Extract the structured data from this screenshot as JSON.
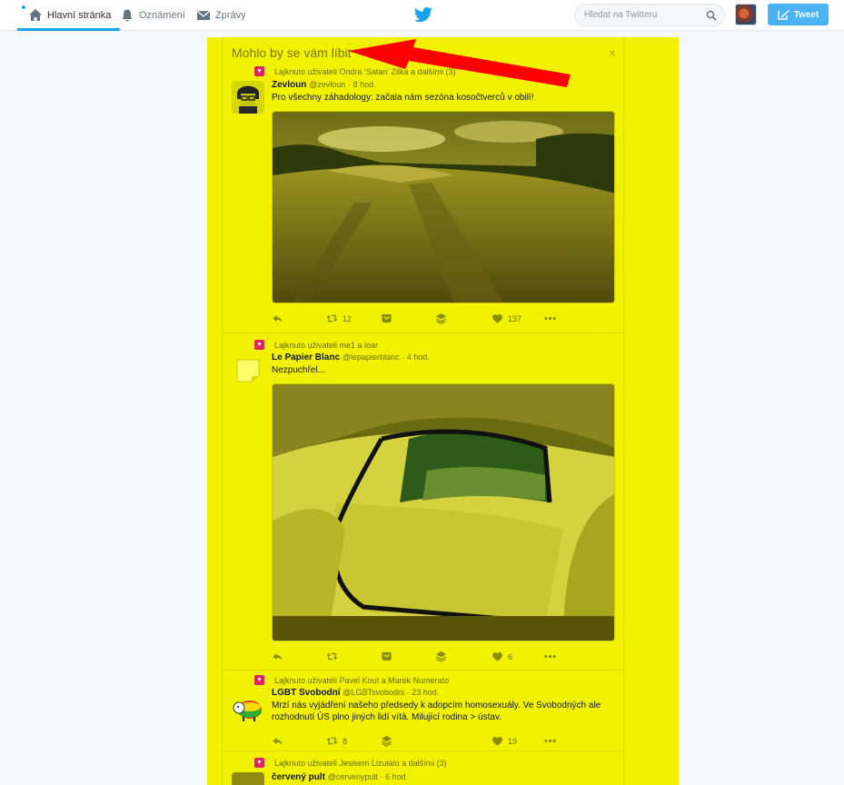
{
  "nav": {
    "home": "Hlavní stránka",
    "notifications": "Oznámení",
    "messages": "Zprávy"
  },
  "search": {
    "placeholder": "Hledat na Twitteru"
  },
  "compose": {
    "label": "Tweet"
  },
  "module": {
    "title": "Mohlo by se vám líbit",
    "close": "×"
  },
  "tweets": [
    {
      "context": "Lajknuto uživateli Ondra 'Satan' Zilka a dalšími (3)",
      "name": "Zevloun",
      "handle": "@zevloun",
      "time": "· 8 hod.",
      "text": "Pro všechny záhadology: začala nám sezóna kosočtverců v obilí!",
      "retweets": "12",
      "likes": "137"
    },
    {
      "context": "Lajknuto uživateli me1 a loar",
      "name": "Le Papier Blanc",
      "handle": "@lepapierblanc",
      "time": "· 4 hod.",
      "text": "Nezpuchřel...",
      "retweets": "",
      "likes": "6"
    },
    {
      "context": "Lajknuto uživateli Pavel Kout a Marek Numerato",
      "name": "LGBT Svobodní",
      "handle": "@LGBTsvobodni",
      "time": "· 23 hod.",
      "text": "Mrzí nás vyjádření našeho předsedy k adopcím homosexuály. Ve Svobodných ale rozhodnutí ÚS plno jiných lidí vítá. Milující rodina > ústav.",
      "retweets": "8",
      "likes": "19"
    },
    {
      "context": "Lajknuto uživateli Jesisem Lizulalo a dalšími (3)",
      "name": "červený pult",
      "handle": "@cervenypult",
      "time": "· 6 hod.",
      "text": "",
      "retweets": "",
      "likes": ""
    }
  ],
  "icons": {
    "home": "home-icon",
    "bell": "bell-icon",
    "envelope": "envelope-icon",
    "bird": "twitter-bird-icon",
    "search": "search-icon",
    "compose": "compose-icon",
    "reply": "reply-icon",
    "retweet": "retweet-icon",
    "dm": "direct-message-icon",
    "moments": "layers-icon",
    "like": "heart-icon",
    "more": "more-icon"
  },
  "colors": {
    "accent": "#1da1f2",
    "highlight": "#f2f200",
    "arrow": "#ff0000"
  }
}
